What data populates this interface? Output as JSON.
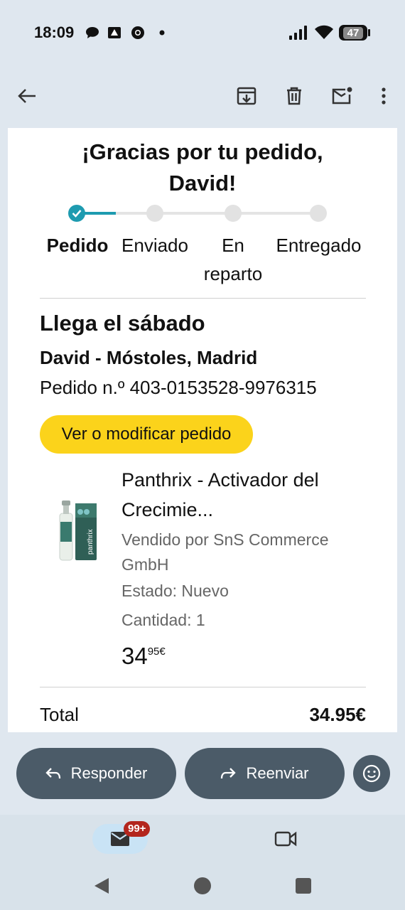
{
  "status_bar": {
    "time": "18:09",
    "battery": "47"
  },
  "email": {
    "title_line1": "¡Gracias por tu pedido,",
    "title_line2": "David!",
    "steps": [
      "Pedido",
      "Enviado",
      "En reparto",
      "Entregado"
    ],
    "step_label_en": "En",
    "step_label_reparto": "reparto",
    "arrival": "Llega el sábado",
    "address": "David - Móstoles, Madrid",
    "order_number": "Pedido n.º 403-0153528-9976315",
    "view_button": "Ver o modificar pedido",
    "product": {
      "name_line1": "Panthrix - Activador del",
      "name_line2": "Crecimie...",
      "seller_line1": "Vendido por SnS Commerce",
      "seller_line2": "GmbH",
      "state": "Estado: Nuevo",
      "quantity": "Cantidad: 1",
      "price_whole": "34",
      "price_cents": "95€",
      "image_brand": "panthrix"
    },
    "total_label": "Total",
    "total_value": "34.95€"
  },
  "actions": {
    "reply": "Responder",
    "forward": "Reenviar"
  },
  "nav": {
    "mail_badge": "99+"
  },
  "colors": {
    "accent": "#1e9bb0",
    "button_yellow": "#fbd31b",
    "pill": "#4b5b68",
    "badge": "#b3261e"
  }
}
